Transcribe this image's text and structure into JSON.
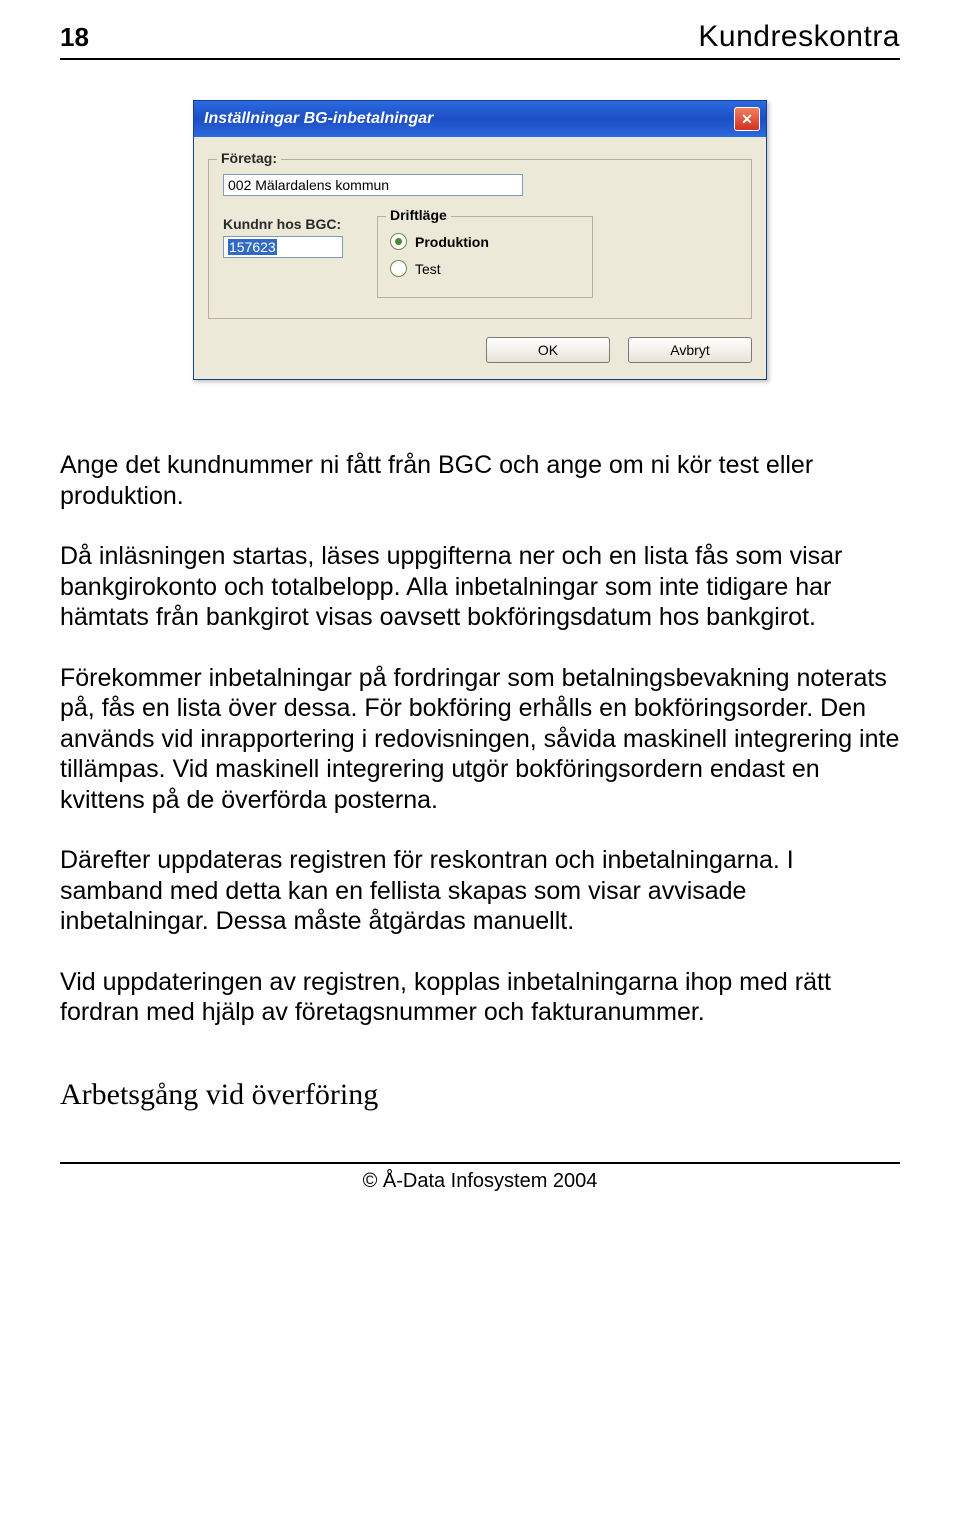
{
  "header": {
    "page_number": "18",
    "doc_title": "Kundreskontra"
  },
  "dialog": {
    "title": "Inställningar BG-inbetalningar",
    "company_label": "Företag:",
    "company_value": "002 Mälardalens kommun",
    "kundnr_label": "Kundnr hos BGC:",
    "kundnr_value": "157623",
    "mode_legend": "Driftläge",
    "radio_prod": "Produktion",
    "radio_test": "Test",
    "ok_label": "OK",
    "cancel_label": "Avbryt"
  },
  "paragraphs": {
    "p1": "Ange det kundnummer ni fått från BGC och ange om ni kör test eller produktion.",
    "p2": "Då inläsningen startas, läses uppgifterna ner och en lista fås som visar bankgirokonto och totalbelopp. Alla inbetalningar som inte tidigare har hämtats från bankgirot visas oavsett bokföringsdatum hos bankgirot.",
    "p3": "Förekommer inbetalningar på fordringar som betalningsbevakning noterats på, fås en lista över dessa. För bokföring erhålls en bokföringsorder. Den används vid inrapportering i redovisningen, såvida maskinell integrering inte tillämpas. Vid maskinell integrering utgör bokföringsordern endast en kvittens på de överförda posterna.",
    "p4": "Därefter uppdateras registren för reskontran och inbetalningarna. I samband med detta kan en fellista skapas som visar avvisade inbetalningar. Dessa måste åtgärdas manuellt.",
    "p5": "Vid uppdateringen av registren, kopplas inbetalningarna ihop med rätt fordran med hjälp av företagsnummer och fakturanummer.",
    "heading": "Arbetsgång vid överföring"
  },
  "footer": "© Å-Data Infosystem 2004"
}
